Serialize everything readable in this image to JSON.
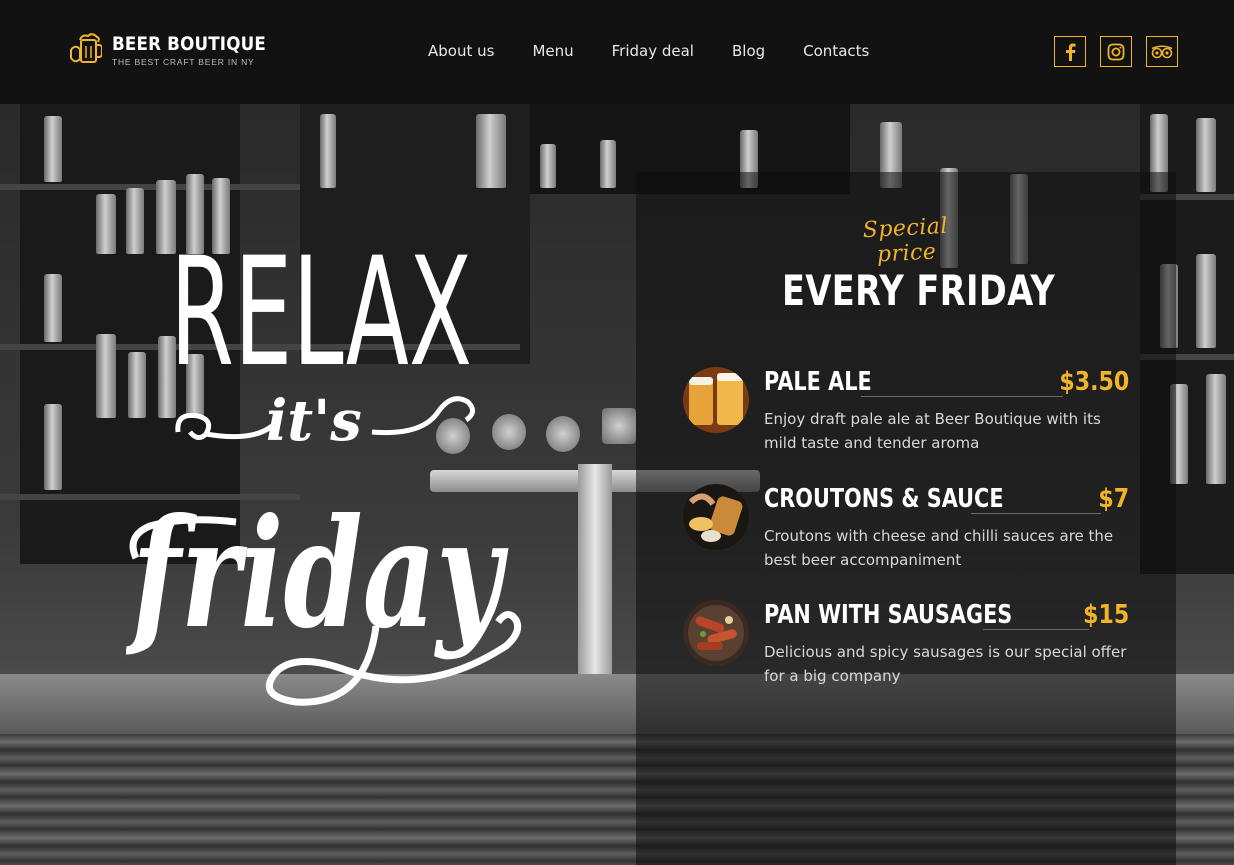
{
  "brand": {
    "name": "BEER BOUTIQUE",
    "tagline": "THE BEST CRAFT BEER IN NY"
  },
  "nav": {
    "items": [
      "About us",
      "Menu",
      "Friday deal",
      "Blog",
      "Contacts"
    ]
  },
  "social": {
    "items": [
      "facebook-icon",
      "instagram-icon",
      "tripadvisor-icon"
    ]
  },
  "hero": {
    "headline_1": "RELAX",
    "headline_2": "it's",
    "headline_3": "friday"
  },
  "menu": {
    "kicker": "Special price",
    "title": "EVERY FRIDAY",
    "items": [
      {
        "name": "PALE ALE",
        "price": "$3.50",
        "description": "Enjoy draft pale ale at Beer Boutique with its mild taste and tender aroma"
      },
      {
        "name": "CROUTONS & SAUCE",
        "price": "$7",
        "description": "Croutons with cheese and chilli sauces are the best beer accompaniment"
      },
      {
        "name": "PAN WITH SAUSAGES",
        "price": "$15",
        "description": "Delicious and spicy sausages is our special offer for a big company"
      }
    ]
  },
  "colors": {
    "accent": "#f0b429",
    "header_bg": "#121212",
    "text": "#ffffff"
  }
}
